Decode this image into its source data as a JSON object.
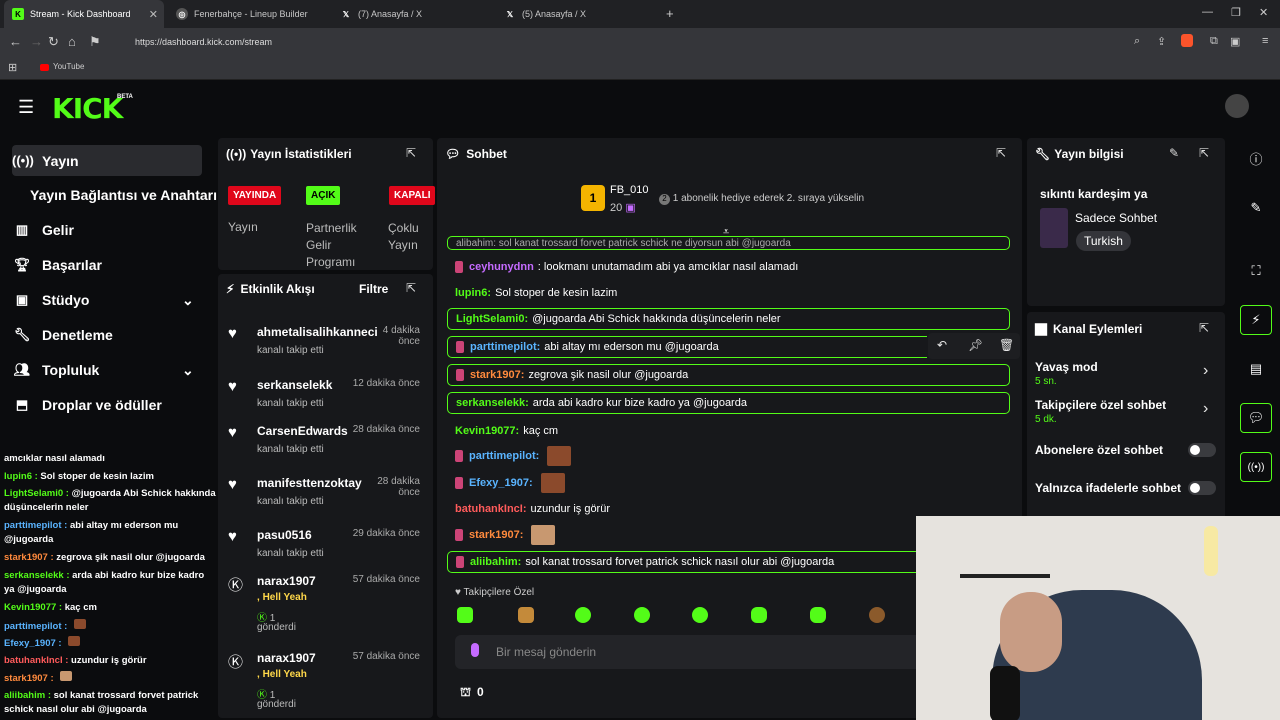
{
  "browser": {
    "tabs": [
      {
        "title": "Stream - Kick Dashboard",
        "active": true
      },
      {
        "title": "Fenerbahçe - Lineup Builder"
      },
      {
        "title": "(7) Anasayfa / X"
      },
      {
        "title": "(5) Anasayfa / X"
      }
    ],
    "url": "https://dashboard.kick.com/stream",
    "bookmark": "YouTube"
  },
  "brand": {
    "logo": "KICK",
    "beta": "BETA",
    "accent": "#53fc18"
  },
  "sidebar": {
    "items": [
      {
        "label": "Yayın",
        "icon": "broadcast-icon",
        "active": true
      },
      {
        "label": "Yayın Bağlantısı ve Anahtarı"
      },
      {
        "label": "Gelir",
        "icon": "chart-icon"
      },
      {
        "label": "Başarılar",
        "icon": "trophy-icon"
      },
      {
        "label": "Stüdyo",
        "icon": "studio-icon"
      },
      {
        "label": "Denetleme",
        "icon": "wrench-icon"
      },
      {
        "label": "Topluluk",
        "icon": "people-icon"
      },
      {
        "label": "Droplar ve ödüller",
        "icon": "gift-icon"
      }
    ]
  },
  "stats": {
    "title": "Yayın İstatistikleri",
    "badges": [
      {
        "text": "YAYINDA",
        "sub": "Yayın"
      },
      {
        "text": "AÇIK",
        "sub": "Partnerlik Gelir Programı"
      },
      {
        "text": "KAPALI",
        "sub": "Çoklu Yayın"
      }
    ]
  },
  "activity": {
    "title": "Etkinlik Akışı",
    "filter": "Filtre",
    "items": [
      {
        "name": "ahmetalisalihkanneci",
        "sub": "kanalı takip etti",
        "time": "4 dakika önce"
      },
      {
        "name": "serkanselekk",
        "sub": "kanalı takip etti",
        "time": "12 dakika önce"
      },
      {
        "name": "CarsenEdwards",
        "sub": "kanalı takip etti",
        "time": "28 dakika önce"
      },
      {
        "name": "manifesttenzoktay",
        "sub": "kanalı takip etti",
        "time": "28 dakika önce"
      },
      {
        "name": "pasu0516",
        "sub": "kanalı takip etti",
        "time": "29 dakika önce"
      },
      {
        "name": "narax1907",
        "sub": "Hell Yeah",
        "count": "1",
        "sent": "gönderdi",
        "time": "57 dakika önce"
      },
      {
        "name": "narax1907",
        "sub": "Hell Yeah",
        "count": "1",
        "sent": "gönderdi",
        "time": "57 dakika önce"
      }
    ]
  },
  "chat": {
    "title": "Sohbet",
    "leader": {
      "rank": "1",
      "name": "FB_010",
      "count": "20"
    },
    "promo": "1 abonelik hediye ederek 2. sıraya yükselin",
    "top_cut": "alibahim: sol kanat trossard forvet patrick schick ne diyorsun abi @jugoarda",
    "messages": [
      {
        "user": "ceyhunydnn",
        "text": "lookmanı unutamadım abi ya amcıklar nasıl alamadı",
        "color": "#c56bff",
        "badge": true
      },
      {
        "user": "lupin6:",
        "text": "Sol stoper de kesin lazim",
        "color": "#53fc18"
      },
      {
        "user": "LightSelami0:",
        "text": "@jugoarda Abi Schick hakkında düşüncelerin neler",
        "color": "#53fc18",
        "hl": true
      },
      {
        "user": "parttimepilot:",
        "text": "abi altay mı ederson mu @jugoarda",
        "color": "#5ab4ff",
        "hl": true,
        "badge": true
      },
      {
        "user": "stark1907:",
        "text": "zegrova şik nasil olur @jugoarda",
        "color": "#ff8a3d",
        "hl": true,
        "badge": true
      },
      {
        "user": "serkanselekk:",
        "text": "arda abi kadro kur bize kadro ya @jugoarda",
        "color": "#53fc18",
        "hl": true
      },
      {
        "user": "Kevin19077:",
        "text": "kaç cm",
        "color": "#53fc18"
      },
      {
        "user": "parttimepilot:",
        "text": "",
        "color": "#5ab4ff",
        "badge": true,
        "emote": true
      },
      {
        "user": "Efexy_1907:",
        "text": "",
        "color": "#5ab4ff",
        "badge": true,
        "emote": true
      },
      {
        "user": "batuhankIncI:",
        "text": "uzundur iş görür",
        "color": "#ff5b5b"
      },
      {
        "user": "stark1907:",
        "text": "",
        "color": "#ff8a3d",
        "badge": true,
        "emote": true
      },
      {
        "user": "aliibahim:",
        "text": "sol kanat trossard forvet patrick schick nasıl olur abi @jugoarda",
        "color": "#53fc18",
        "hl": true,
        "badge": true
      }
    ],
    "emote_tab": "Takipçilere Özel",
    "input_placeholder": "Bir mesaj gönderin",
    "points": "0"
  },
  "info": {
    "title": "Yayın bilgisi",
    "stream_title": "sıkıntı kardeşim ya",
    "category": "Sadece Sohbet",
    "language": "Turkish"
  },
  "actions": {
    "title": "Kanal Eylemleri",
    "items": [
      {
        "label": "Yavaş mod",
        "value": "5 sn.",
        "type": "arrow"
      },
      {
        "label": "Takipçilere özel sohbet",
        "value": "5 dk.",
        "type": "arrow"
      },
      {
        "label": "Abonelere özel sohbet",
        "type": "toggle"
      },
      {
        "label": "Yalnızca ifadelerle sohbet",
        "type": "toggle"
      }
    ]
  },
  "overlay_chat": [
    {
      "user": "",
      "text": "amcıklar nasıl alamadı",
      "color": "#fff"
    },
    {
      "user": "lupin6 :",
      "text": "Sol stoper de kesin lazim",
      "color": "#53fc18"
    },
    {
      "user": "LightSelami0 :",
      "text": "@jugoarda Abi Schick hakkında düşüncelerin neler",
      "color": "#53fc18"
    },
    {
      "user": "parttimepilot :",
      "text": "abi altay mı ederson mu @jugoarda",
      "color": "#5ab4ff"
    },
    {
      "user": "stark1907 :",
      "text": "zegrova şik nasil olur @jugoarda",
      "color": "#ff8a3d"
    },
    {
      "user": "serkanselekk :",
      "text": "arda abi kadro kur bize kadro ya @jugoarda",
      "color": "#53fc18"
    },
    {
      "user": "Kevin19077 :",
      "text": "kaç cm",
      "color": "#53fc18"
    },
    {
      "user": "parttimepilot :",
      "text": "",
      "color": "#5ab4ff"
    },
    {
      "user": "Efexy_1907 :",
      "text": "",
      "color": "#5ab4ff"
    },
    {
      "user": "batuhankIncI :",
      "text": "uzundur iş görür",
      "color": "#ff5b5b"
    },
    {
      "user": "stark1907 :",
      "text": "",
      "color": "#ff8a3d"
    },
    {
      "user": "aliibahim :",
      "text": "sol kanat trossard forvet patrick schick nasıl olur abi @jugoarda",
      "color": "#53fc18"
    }
  ]
}
